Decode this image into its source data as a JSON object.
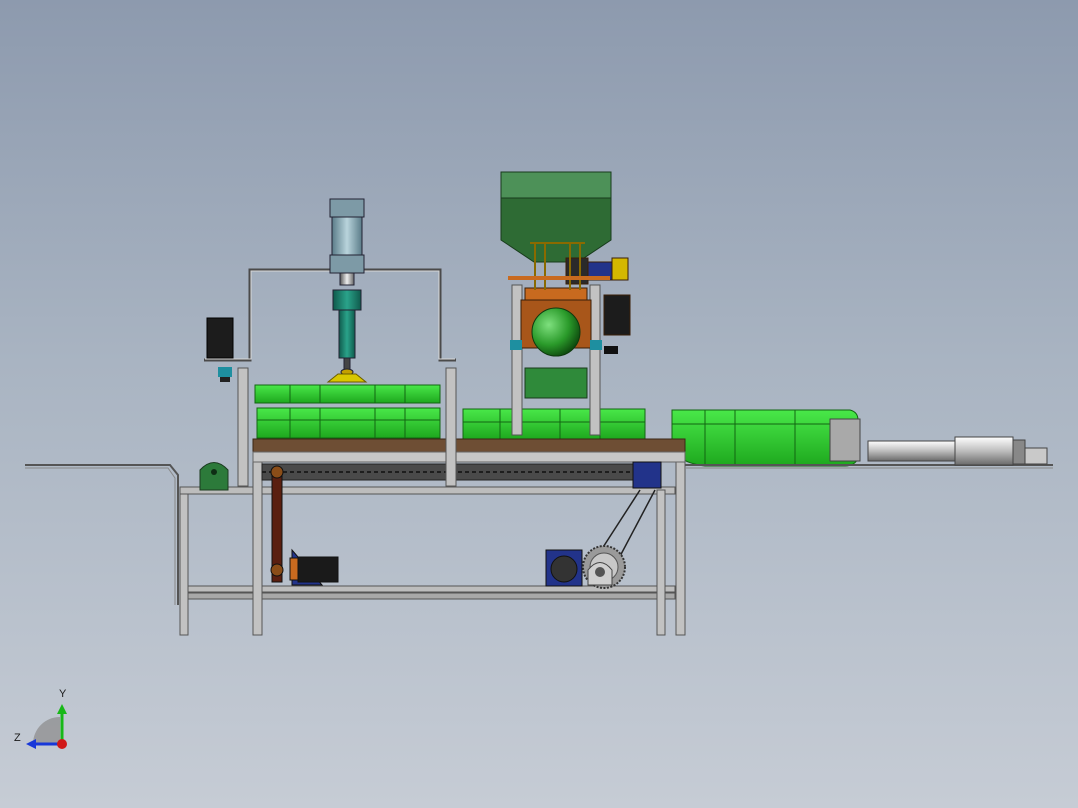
{
  "scene": {
    "colors": {
      "background_top": "#8d9aae",
      "background_bottom": "#c6ccd5",
      "tray_green": "#2fd22f",
      "frame_gray": "#b9b9b9",
      "table_top_brown": "#6e4e34",
      "hopper_green": "#2e6b34",
      "motor_blue": "#22338a",
      "pump_orange": "#c86a1f",
      "axis_x_red": "#d01818",
      "axis_y_green": "#18b818",
      "axis_z_blue": "#1838d8"
    }
  },
  "triad": {
    "y_label": "Y",
    "z_label": "Z"
  }
}
